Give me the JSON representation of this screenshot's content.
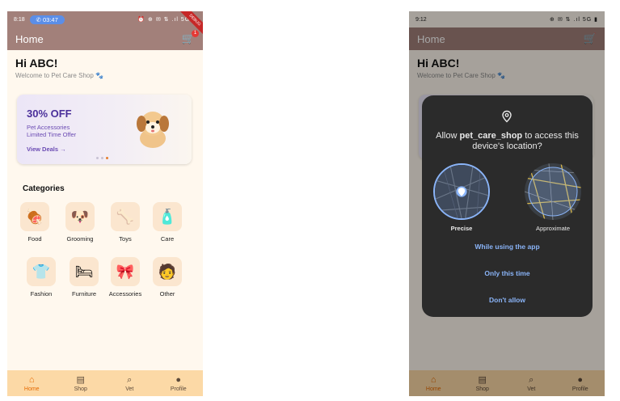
{
  "left": {
    "status": {
      "time": "8:18",
      "call": "03:47",
      "icons": "⏰ ⊕ ✉ ⇅ .ıl 5G ▮"
    },
    "appbar": {
      "title": "Home",
      "cart_count": "1",
      "debug": "DEBUG"
    },
    "greeting": {
      "title": "Hi ABC!",
      "subtitle": "Welcome to Pet Care Shop 🐾"
    },
    "promo": {
      "off": "30% OFF",
      "line1": "Pet Accessories",
      "line2": "Limited Time Offer",
      "link": "View Deals →"
    },
    "categories_title": "Categories",
    "categories": [
      {
        "label": "Food",
        "icon": "🍖"
      },
      {
        "label": "Grooming",
        "icon": "🐶"
      },
      {
        "label": "Toys",
        "icon": "🦴"
      },
      {
        "label": "Care",
        "icon": "🧴"
      },
      {
        "label": "Fashion",
        "icon": "👕"
      },
      {
        "label": "Furniture",
        "icon": "🛏"
      },
      {
        "label": "Accessories",
        "icon": "🎀"
      },
      {
        "label": "Other",
        "icon": "🧑"
      }
    ],
    "nav": [
      {
        "label": "Home",
        "icon": "⌂"
      },
      {
        "label": "Shop",
        "icon": "▤"
      },
      {
        "label": "Vet",
        "icon": "⌕"
      },
      {
        "label": "Profile",
        "icon": "●"
      }
    ]
  },
  "right": {
    "status": {
      "time": "9:12",
      "icons": "⊕ ✉ ⇅ .ıl 5G ▮"
    },
    "appbar": {
      "title": "Home"
    },
    "greeting": {
      "title": "Hi ABC!",
      "subtitle": "Welcome to Pet Care Shop 🐾"
    },
    "dialog": {
      "title_pre": "Allow ",
      "app_name": "pet_care_shop",
      "title_post": " to access this device's location?",
      "precise": "Precise",
      "approximate": "Approximate",
      "while_using": "While using the app",
      "only_this_time": "Only this time",
      "dont_allow": "Don't allow"
    },
    "nav": [
      {
        "label": "Home"
      },
      {
        "label": "Shop"
      },
      {
        "label": "Vet"
      },
      {
        "label": "Profile"
      }
    ]
  },
  "colors": {
    "accent": "#e66a00",
    "appbar": "#a2807a",
    "link_blue": "#8ab4f8"
  }
}
